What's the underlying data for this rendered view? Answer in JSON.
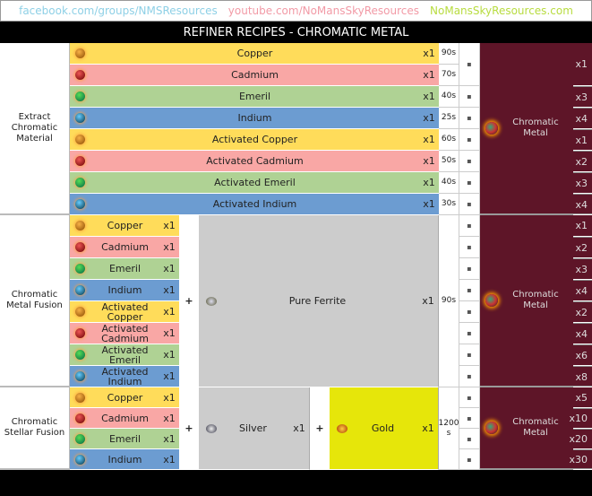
{
  "header": {
    "links": [
      {
        "text": "facebook.com/groups/NMSResources",
        "color": "#8ed0e6"
      },
      {
        "text": "youtube.com/NoMansSkyResources",
        "color": "#f29aa6"
      },
      {
        "text": "NoMansSkyResources.com",
        "color": "#b8dc40"
      }
    ],
    "title": "REFINER RECIPES - CHROMATIC METAL"
  },
  "colors": {
    "Copper": "#ffdc5a",
    "Cadmium": "#f9a7a5",
    "Emeril": "#afd294",
    "Indium": "#6c9cd1",
    "maroon": "#5e1528",
    "gold_bg": "#e6e60a"
  },
  "equals": "▪",
  "sections": [
    {
      "label": "Extract Chromatic Material",
      "ingredients": [
        {
          "name": "Copper",
          "type": "Copper",
          "qty": "x1",
          "time": "90s"
        },
        {
          "name": "Cadmium",
          "type": "Cadmium",
          "qty": "x1",
          "time": "70s"
        },
        {
          "name": "Emeril",
          "type": "Emeril",
          "qty": "x1",
          "time": "40s"
        },
        {
          "name": "Indium",
          "type": "Indium",
          "qty": "x1",
          "time": "25s"
        },
        {
          "name": "Activated Copper",
          "type": "Copper",
          "qty": "x1",
          "time": "60s"
        },
        {
          "name": "Activated Cadmium",
          "type": "Cadmium",
          "qty": "x1",
          "time": "50s"
        },
        {
          "name": "Activated Emeril",
          "type": "Emeril",
          "qty": "x1",
          "time": "40s"
        },
        {
          "name": "Activated Indium",
          "type": "Indium",
          "qty": "x1",
          "time": "30s"
        }
      ],
      "result": "Chromatic Metal",
      "outputs": [
        "x1",
        "x3",
        "x4",
        "x1",
        "x2",
        "x3",
        "x4"
      ]
    },
    {
      "label": "Chromatic Metal Fusion",
      "ingredients": [
        {
          "name": "Copper",
          "type": "Copper",
          "qty": "x1"
        },
        {
          "name": "Cadmium",
          "type": "Cadmium",
          "qty": "x1"
        },
        {
          "name": "Emeril",
          "type": "Emeril",
          "qty": "x1"
        },
        {
          "name": "Indium",
          "type": "Indium",
          "qty": "x1"
        },
        {
          "name": "Activated Copper",
          "type": "Copper",
          "qty": "x1"
        },
        {
          "name": "Activated Cadmium",
          "type": "Cadmium",
          "qty": "x1"
        },
        {
          "name": "Activated Emeril",
          "type": "Emeril",
          "qty": "x1"
        },
        {
          "name": "Activated Indium",
          "type": "Indium",
          "qty": "x1"
        }
      ],
      "plus": "+",
      "extra": [
        {
          "name": "Pure Ferrite",
          "qty": "x1"
        }
      ],
      "time": "90s",
      "result": "Chromatic Metal",
      "outputs": [
        "x1",
        "x2",
        "x3",
        "x4",
        "x2",
        "x4",
        "x6",
        "x8"
      ]
    },
    {
      "label": "Chromatic Stellar Fusion",
      "ingredients": [
        {
          "name": "Copper",
          "type": "Copper",
          "qty": "x1"
        },
        {
          "name": "Cadmium",
          "type": "Cadmium",
          "qty": "x1"
        },
        {
          "name": "Emeril",
          "type": "Emeril",
          "qty": "x1"
        },
        {
          "name": "Indium",
          "type": "Indium",
          "qty": "x1"
        }
      ],
      "plus": "+",
      "extra": [
        {
          "name": "Silver",
          "qty": "x1"
        },
        {
          "name": "Gold",
          "qty": "x1"
        }
      ],
      "time": "1200 s",
      "result": "Chromatic Metal",
      "outputs": [
        "x5",
        "x10",
        "x20",
        "x30"
      ]
    }
  ]
}
